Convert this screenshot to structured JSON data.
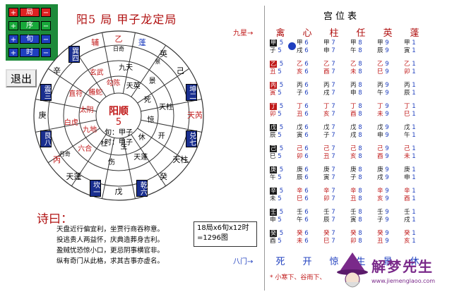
{
  "controls": [
    {
      "minus": "+",
      "label": "局",
      "plus": "−"
    },
    {
      "minus": "+",
      "label": "序",
      "plus": "−"
    },
    {
      "minus": "+",
      "label": "旬",
      "plus": "−"
    },
    {
      "minus": "+",
      "label": "时",
      "plus": "−"
    }
  ],
  "exit_label": "退出",
  "title": "阳5 局  甲子龙定局",
  "wheel": {
    "center_top": "阳顺",
    "center_num": "5",
    "center_l1": "旬：甲子",
    "center_l2": "时：甲子",
    "sectors": [
      {
        "t": "乙",
        "s": "日奇",
        "c": "red"
      },
      {
        "t": "蓬",
        "s": "",
        "c": "blue"
      },
      {
        "t": "英",
        "s": "景",
        "c": ""
      },
      {
        "t": "己",
        "s": "",
        "c": ""
      },
      {
        "t": "坤二",
        "s": "",
        "c": "box"
      },
      {
        "t": "天芮",
        "s": "",
        "c": "red"
      },
      {
        "t": "兑七",
        "s": "",
        "c": "box"
      },
      {
        "t": "天柱",
        "s": "",
        "c": ""
      },
      {
        "t": "癸",
        "s": "",
        "c": ""
      },
      {
        "t": "乾六",
        "s": "",
        "c": "box"
      },
      {
        "t": "戊",
        "s": "",
        "c": ""
      },
      {
        "t": "坎一",
        "s": "",
        "c": "box"
      },
      {
        "t": "天蓬",
        "s": "",
        "c": ""
      },
      {
        "t": "丙",
        "s": "月奇",
        "c": "red"
      },
      {
        "t": "艮八",
        "s": "",
        "c": "box"
      },
      {
        "t": "庚",
        "s": "",
        "c": ""
      },
      {
        "t": "震三",
        "s": "",
        "c": "box"
      },
      {
        "t": "辛",
        "s": "",
        "c": ""
      },
      {
        "t": "巽四",
        "s": "",
        "c": "box"
      },
      {
        "t": "辅",
        "s": "",
        "c": "red"
      }
    ],
    "inner": [
      "九天",
      "天英",
      "景",
      "死",
      "天柱",
      "惊",
      "开",
      "休",
      "天蓬",
      "生",
      "伤",
      "杜",
      "六合",
      "九地",
      "白虎",
      "太阴",
      "直符",
      "螣蛇",
      "玄武",
      "勾陈"
    ]
  },
  "poem_header": "诗曰：",
  "poem_lines": [
    "天盘近行偏宜利，坐贾行商吞称意。",
    "投逃贵人两益怀，庆典造葬身吉利。",
    "盈贼忧恐惊小口，更忌阴事横官非。",
    "纵有奇门从此格，求其吉事亦虚名。"
  ],
  "calc_box": "18局x6旬x12时 =1296图",
  "table": {
    "title": "宫位表",
    "jiuxing_label": "九星→",
    "bamen_label": "八门→",
    "stars": [
      "禽",
      "心",
      "柱",
      "任",
      "英",
      "蓬"
    ],
    "doors": [
      "死",
      "开",
      "惊",
      "生",
      "景",
      "休"
    ],
    "rows": [
      [
        "甲子",
        "甲戌",
        "甲申",
        "甲午",
        "甲辰",
        "甲寅"
      ],
      [
        "乙丑",
        "乙亥",
        "乙酉",
        "乙未",
        "乙巳",
        "乙卯"
      ],
      [
        "丙寅",
        "丙子",
        "丙戌",
        "丙申",
        "丙午",
        "丙辰"
      ],
      [
        "丁卯",
        "丁丑",
        "丁亥",
        "丁酉",
        "丁未",
        "丁巳"
      ],
      [
        "戊辰",
        "戊寅",
        "戊子",
        "戊戌",
        "戊申",
        "戊午"
      ],
      [
        "己巳",
        "己卯",
        "己丑",
        "己亥",
        "己酉",
        "己未"
      ],
      [
        "庚午",
        "庚辰",
        "庚寅",
        "庚子",
        "庚戌",
        "庚申"
      ],
      [
        "辛未",
        "辛巳",
        "辛卯",
        "辛丑",
        "辛亥",
        "辛酉"
      ],
      [
        "壬申",
        "壬午",
        "壬辰",
        "壬寅",
        "壬子",
        "壬戌"
      ],
      [
        "癸酉",
        "癸未",
        "癸巳",
        "癸卯",
        "癸丑",
        "癸亥"
      ]
    ],
    "nums": [
      [
        "5",
        "6",
        "7",
        "8",
        "9",
        "1"
      ],
      [
        "5",
        "6",
        "7",
        "8",
        "9",
        "1"
      ],
      [
        "5",
        "6",
        "7",
        "8",
        "9",
        "1"
      ],
      [
        "5",
        "6",
        "7",
        "8",
        "9",
        "1"
      ],
      [
        "5",
        "6",
        "7",
        "8",
        "9",
        "1"
      ],
      [
        "5",
        "6",
        "7",
        "8",
        "9",
        "1"
      ],
      [
        "5",
        "6",
        "7",
        "8",
        "9",
        "1"
      ],
      [
        "5",
        "6",
        "7",
        "8",
        "9",
        "1"
      ],
      [
        "5",
        "6",
        "7",
        "8",
        "9",
        "1"
      ],
      [
        "5",
        "6",
        "7",
        "8",
        "9",
        "1"
      ]
    ],
    "footnote": "* 小寒下、谷雨下、"
  },
  "watermark": {
    "name": "解梦先生",
    "url": "www.jiemenglaoo.com"
  }
}
